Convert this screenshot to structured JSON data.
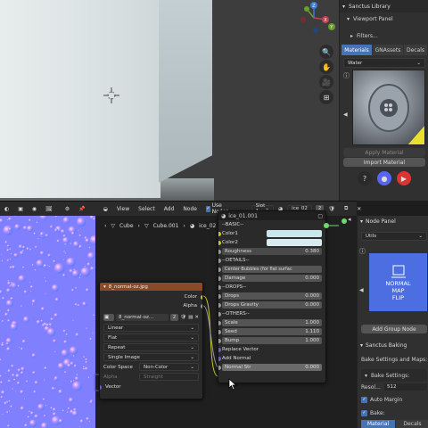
{
  "sanctus": {
    "title": "Sanctus Library",
    "viewport_panel": "Viewport Panel",
    "filters": "Filters...",
    "tabs": [
      "Materials",
      "GNAssets",
      "Decals"
    ],
    "material_select": "Water",
    "apply_material": "Apply Material",
    "import_material": "Import Material",
    "colors": {
      "active_tab": "#4772b3"
    }
  },
  "toolbar": {
    "slot_num": "2",
    "menus": [
      "View",
      "Select",
      "Add",
      "Node"
    ],
    "use_nodes": "Use Nodes",
    "slot": "Slot 1",
    "material": "ice_02"
  },
  "breadcrumb": {
    "obj": "Cube",
    "mesh": "Cube.001",
    "mat": "ice_02"
  },
  "image_node": {
    "title": "8_normal-oz.jpg",
    "color_out": "Color",
    "alpha_out": "Alpha",
    "image_name": "8_normal-oz...",
    "users": "2",
    "interpolation": "Linear",
    "projection": "Flat",
    "extension": "Repeat",
    "source": "Single Image",
    "color_space_label": "Color Space",
    "color_space": "Non-Color",
    "alpha_label": "Alpha",
    "alpha_mode": "Straight",
    "vector_in": "Vector"
  },
  "group_node": {
    "name": "ice_01.001",
    "basic": "--BASIC--",
    "color1": "Color1",
    "color2": "Color2",
    "roughness_label": "Roughness",
    "roughness": "0.380",
    "details": "--DETAILS--",
    "center_bubbles": "Center Bubbles (for flat surfac",
    "damage_label": "Damage",
    "damage": "0.000",
    "drops_header": "--DROPS--",
    "drops_label": "Drops",
    "drops": "0.000",
    "drops_gravity_label": "Drops Gravity",
    "drops_gravity": "0.000",
    "others": "--OTHERS--",
    "scale_label": "Scale",
    "scale": "1.000",
    "seed_label": "Seed",
    "seed": "1.110",
    "bump_label": "Bump",
    "bump": "1.000",
    "replace_vector": "Replace Vector",
    "add_normal": "Add Normal",
    "normal_str_label": "Normal Str",
    "normal_str": "0.000",
    "colors": {
      "color1": "#c9e6ec",
      "color2": "#d8ecef"
    }
  },
  "node_panel": {
    "title": "Node Panel",
    "category": "Utils",
    "preview_lines": [
      "NORMAL",
      "MAP",
      "FLIP"
    ],
    "add_group": "Add Group Node",
    "baking_title": "Sanctus Baking",
    "bake_desc": "Bake Settings and Maps:",
    "bake_settings": "Bake Settings:",
    "reso_label": "Resol...",
    "reso_value": "512",
    "auto_margin": "Auto Margin",
    "bake_label": "Bake:",
    "bake_tabs": [
      "Material",
      "Decals"
    ],
    "colors": {
      "preview_bg": "#4d6ee0"
    }
  }
}
